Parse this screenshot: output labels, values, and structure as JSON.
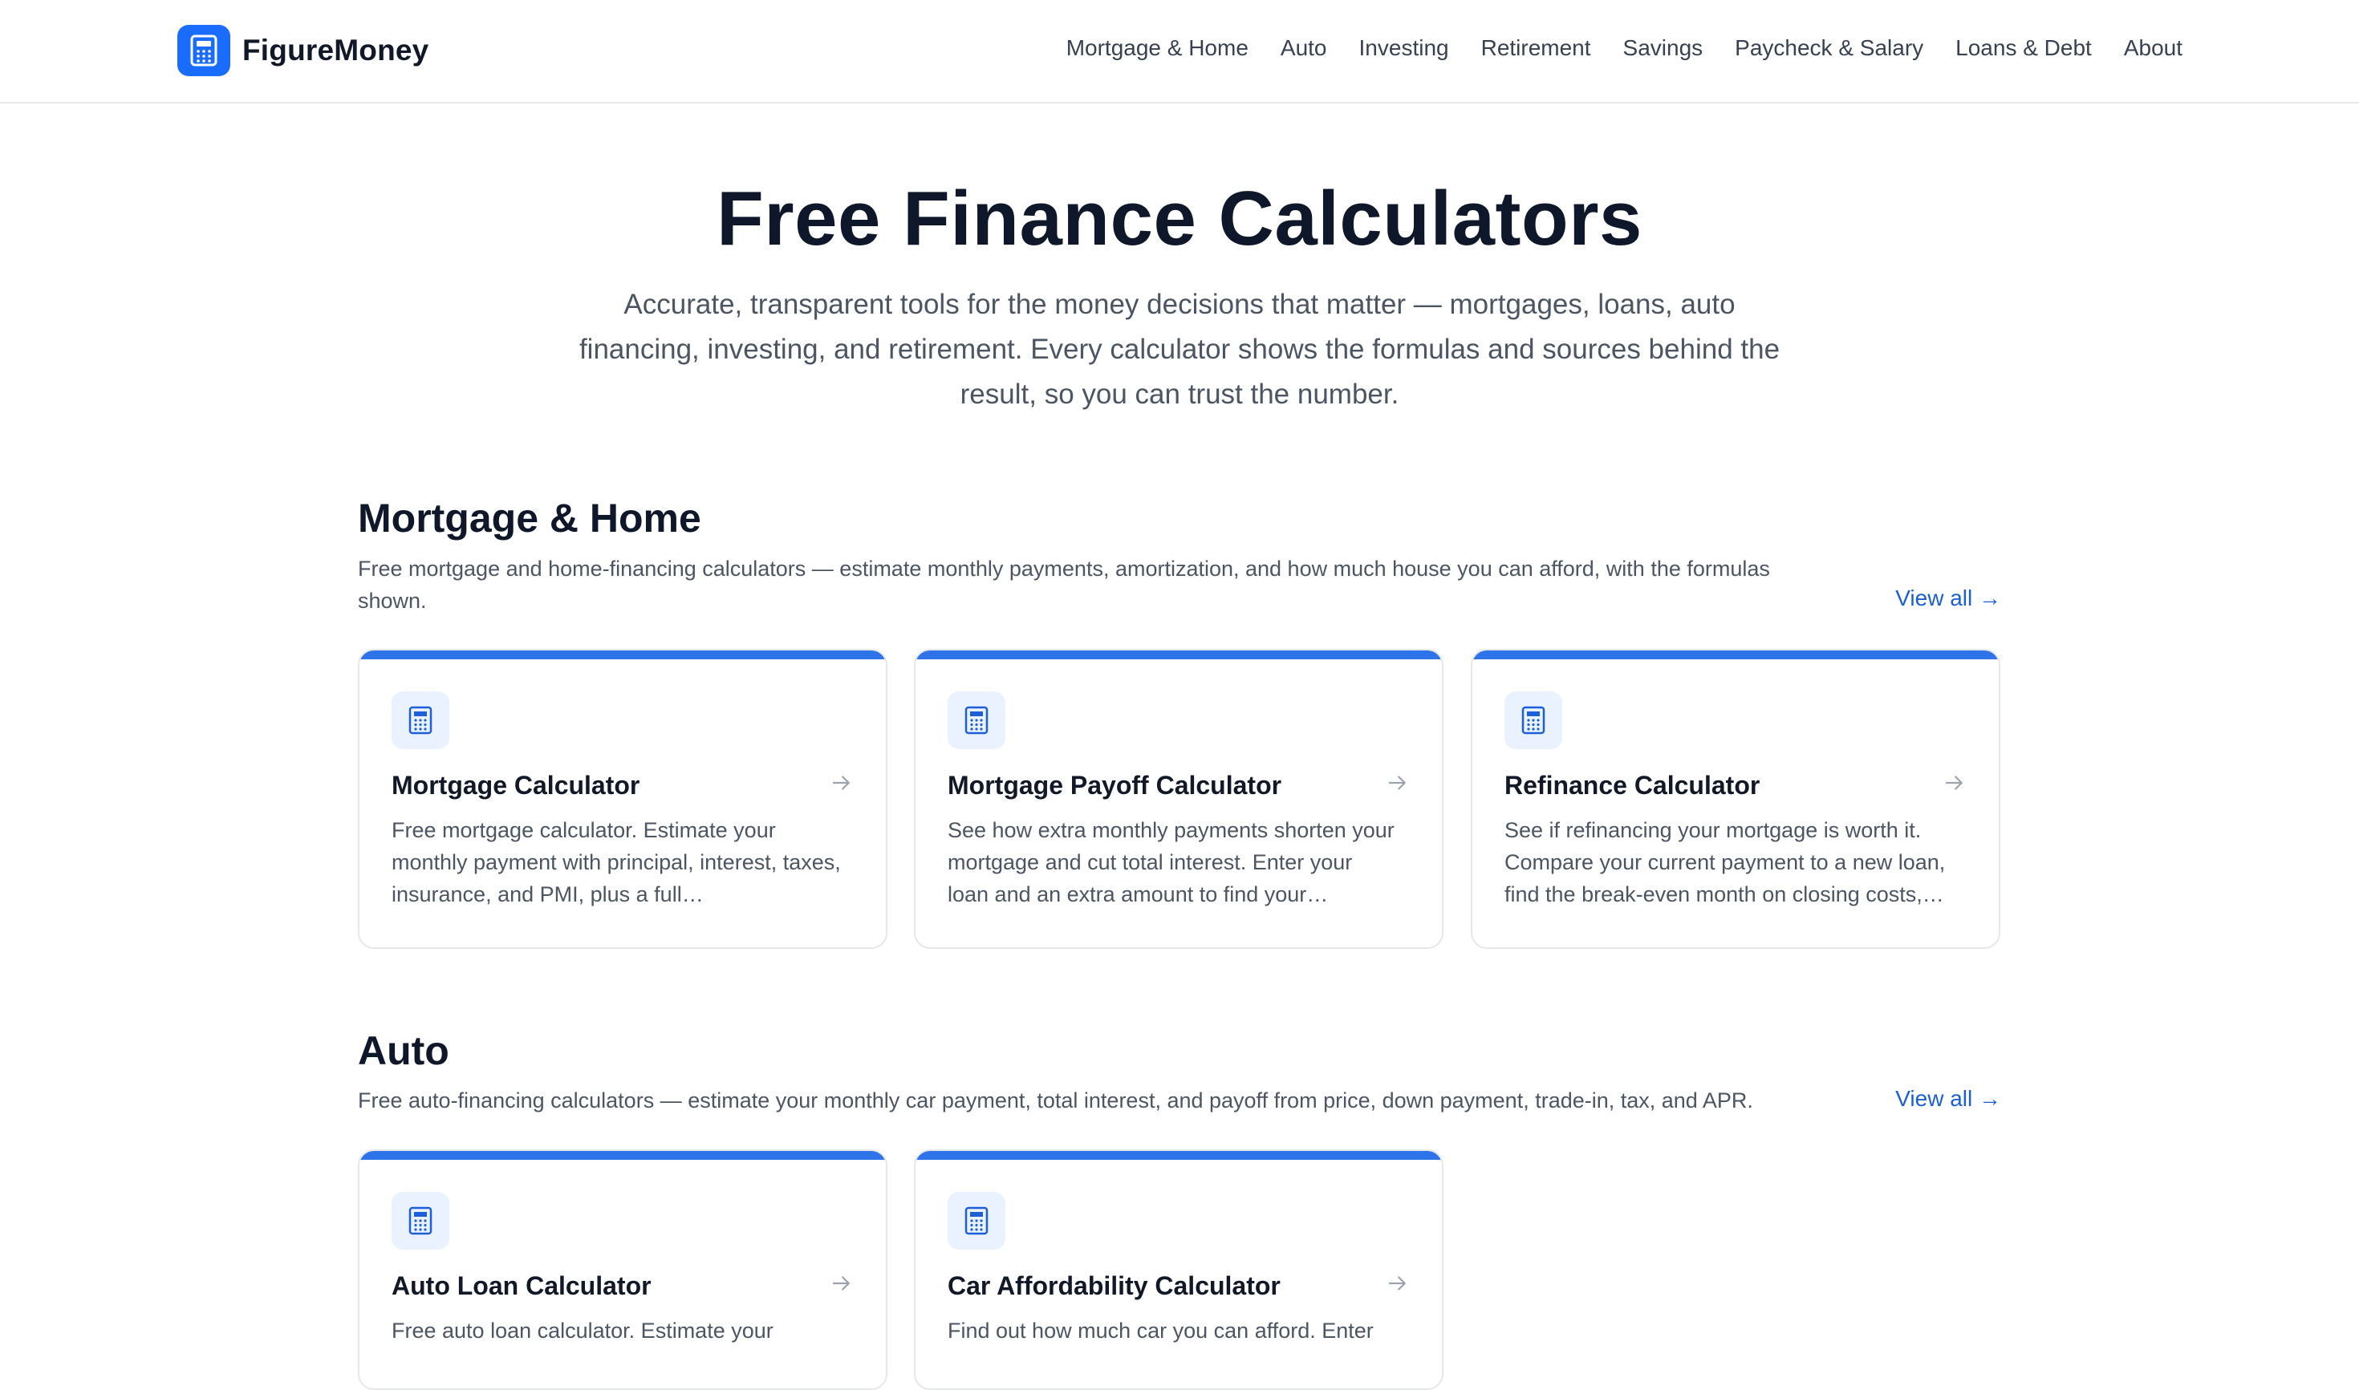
{
  "brand": {
    "name": "FigureMoney",
    "accent": "#1a6cff"
  },
  "nav": {
    "items": [
      {
        "label": "Mortgage & Home"
      },
      {
        "label": "Auto"
      },
      {
        "label": "Investing"
      },
      {
        "label": "Retirement"
      },
      {
        "label": "Savings"
      },
      {
        "label": "Paycheck & Salary"
      },
      {
        "label": "Loans & Debt"
      },
      {
        "label": "About"
      }
    ]
  },
  "hero": {
    "title": "Free Finance Calculators",
    "subtitle": "Accurate, transparent tools for the money decisions that matter — mortgages, loans, auto financing, investing, and retirement. Every calculator shows the formulas and sources behind the result, so you can trust the number."
  },
  "sections": [
    {
      "title": "Mortgage & Home",
      "description": "Free mortgage and home-financing calculators — estimate monthly payments, amortization, and how much house you can afford, with the formulas shown.",
      "view_all": "View all →",
      "cards": [
        {
          "title": "Mortgage Calculator",
          "description": "Free mortgage calculator. Estimate your monthly payment with principal, interest, taxes, insurance, and PMI, plus a full…",
          "icon": "calculator-icon"
        },
        {
          "title": "Mortgage Payoff Calculator",
          "description": "See how extra monthly payments shorten your mortgage and cut total interest. Enter your loan and an extra amount to find your…",
          "icon": "calculator-icon"
        },
        {
          "title": "Refinance Calculator",
          "description": "See if refinancing your mortgage is worth it. Compare your current payment to a new loan, find the break-even month on closing costs,…",
          "icon": "calculator-icon"
        }
      ]
    },
    {
      "title": "Auto",
      "description": "Free auto-financing calculators — estimate your monthly car payment, total interest, and payoff from price, down payment, trade-in, tax, and APR.",
      "view_all": "View all →",
      "cards": [
        {
          "title": "Auto Loan Calculator",
          "description": "Free auto loan calculator. Estimate your",
          "icon": "calculator-icon"
        },
        {
          "title": "Car Affordability Calculator",
          "description": "Find out how much car you can afford. Enter",
          "icon": "calculator-icon"
        }
      ]
    }
  ]
}
